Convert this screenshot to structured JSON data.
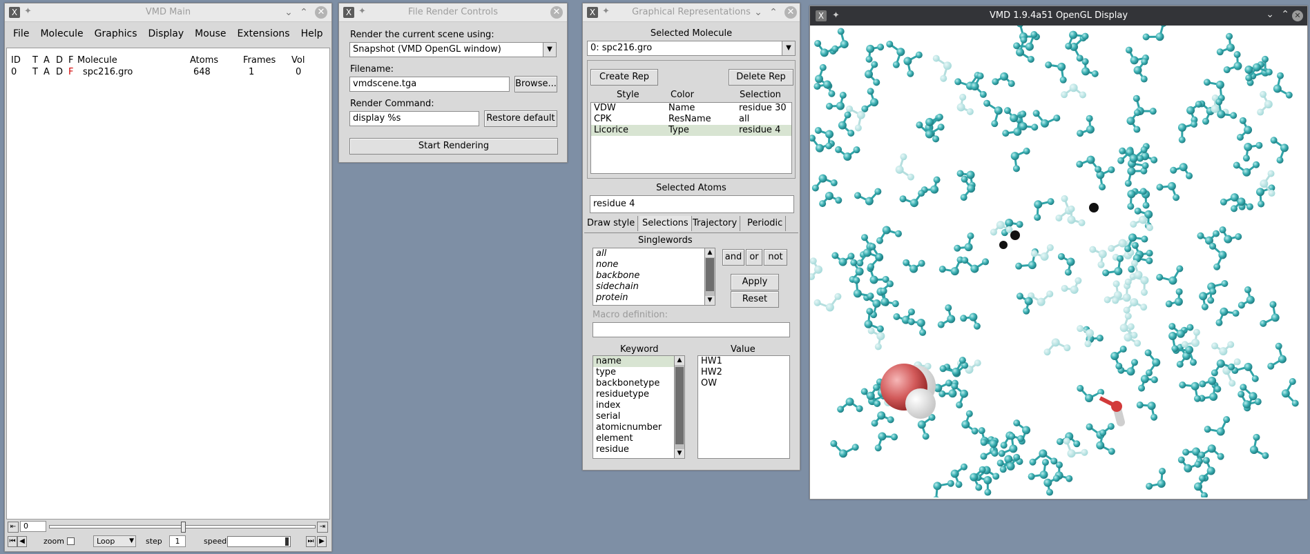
{
  "vmd_main": {
    "title": "VMD Main",
    "menu": [
      "File",
      "Molecule",
      "Graphics",
      "Display",
      "Mouse",
      "Extensions",
      "Help"
    ],
    "columns": {
      "id": "ID",
      "t": "T",
      "a": "A",
      "d": "D",
      "f": "F",
      "molecule": "Molecule",
      "atoms": "Atoms",
      "frames": "Frames",
      "vol": "Vol"
    },
    "row": {
      "id": "0",
      "t": "T",
      "a": "A",
      "d": "D",
      "f": "F",
      "molecule": "spc216.gro",
      "atoms": "648",
      "frames": "1",
      "vol": "0"
    },
    "frame_value": "0",
    "zoom_label": "zoom",
    "loop_value": "Loop",
    "step_label": "step",
    "step_value": "1",
    "speed_label": "speed"
  },
  "render": {
    "title": "File Render Controls",
    "scene_label": "Render the current scene using:",
    "renderer": "Snapshot (VMD OpenGL window)",
    "filename_label": "Filename:",
    "filename": "vmdscene.tga",
    "browse": "Browse...",
    "command_label": "Render Command:",
    "command": "display %s",
    "restore": "Restore default",
    "start": "Start Rendering"
  },
  "reps": {
    "title": "Graphical Representations",
    "selected_molecule_label": "Selected Molecule",
    "selected_molecule": "0: spc216.gro",
    "create": "Create Rep",
    "delete": "Delete Rep",
    "headers": {
      "style": "Style",
      "color": "Color",
      "selection": "Selection"
    },
    "rows": [
      {
        "style": "VDW",
        "color": "Name",
        "selection": "residue 30"
      },
      {
        "style": "CPK",
        "color": "ResName",
        "selection": "all"
      },
      {
        "style": "Licorice",
        "color": "Type",
        "selection": "residue 4"
      }
    ],
    "selected_atoms_label": "Selected Atoms",
    "selected_atoms": "residue 4",
    "tabs": [
      "Draw style",
      "Selections",
      "Trajectory",
      "Periodic"
    ],
    "singlewords_label": "Singlewords",
    "singlewords": [
      "all",
      "none",
      "backbone",
      "sidechain",
      "protein"
    ],
    "and": "and",
    "or": "or",
    "not": "not",
    "apply": "Apply",
    "reset": "Reset",
    "macro_label": "Macro definition:",
    "keyword_label": "Keyword",
    "value_label": "Value",
    "keywords": [
      "name",
      "type",
      "backbonetype",
      "residuetype",
      "index",
      "serial",
      "atomicnumber",
      "element",
      "residue"
    ],
    "values": [
      "HW1",
      "HW2",
      "OW"
    ]
  },
  "display": {
    "title": "VMD 1.9.4a51 OpenGL Display"
  }
}
